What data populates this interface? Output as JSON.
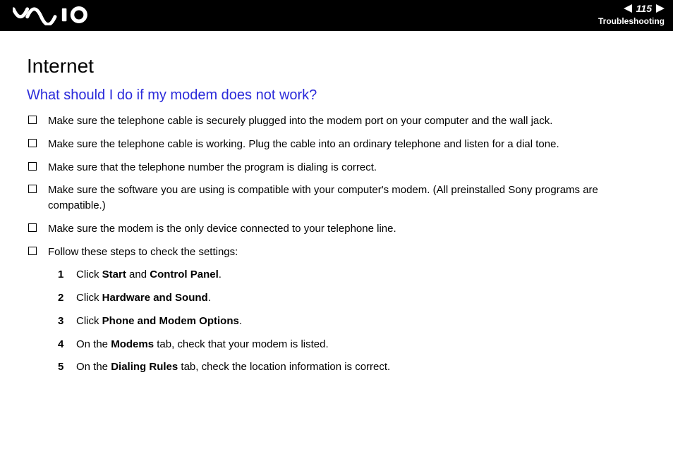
{
  "header": {
    "page_number": "115",
    "section_label": "Troubleshooting"
  },
  "content": {
    "title": "Internet",
    "subtitle": "What should I do if my modem does not work?",
    "bullets": [
      "Make sure the telephone cable is securely plugged into the modem port on your computer and the wall jack.",
      "Make sure the telephone cable is working. Plug the cable into an ordinary telephone and listen for a dial tone.",
      "Make sure that the telephone number the program is dialing is correct.",
      "Make sure the software you are using is compatible with your computer's modem. (All preinstalled Sony programs are compatible.)",
      "Make sure the modem is the only device connected to your telephone line.",
      "Follow these steps to check the settings:"
    ],
    "steps": [
      {
        "prefix": "Click ",
        "bold1": "Start",
        "mid": " and ",
        "bold2": "Control Panel",
        "suffix": "."
      },
      {
        "prefix": "Click ",
        "bold1": "Hardware and Sound",
        "mid": "",
        "bold2": "",
        "suffix": "."
      },
      {
        "prefix": "Click ",
        "bold1": "Phone and Modem Options",
        "mid": "",
        "bold2": "",
        "suffix": "."
      },
      {
        "prefix": "On the ",
        "bold1": "Modems",
        "mid": " tab, check that your modem is listed.",
        "bold2": "",
        "suffix": ""
      },
      {
        "prefix": "On the ",
        "bold1": "Dialing Rules",
        "mid": " tab, check the location information is correct.",
        "bold2": "",
        "suffix": ""
      }
    ]
  }
}
